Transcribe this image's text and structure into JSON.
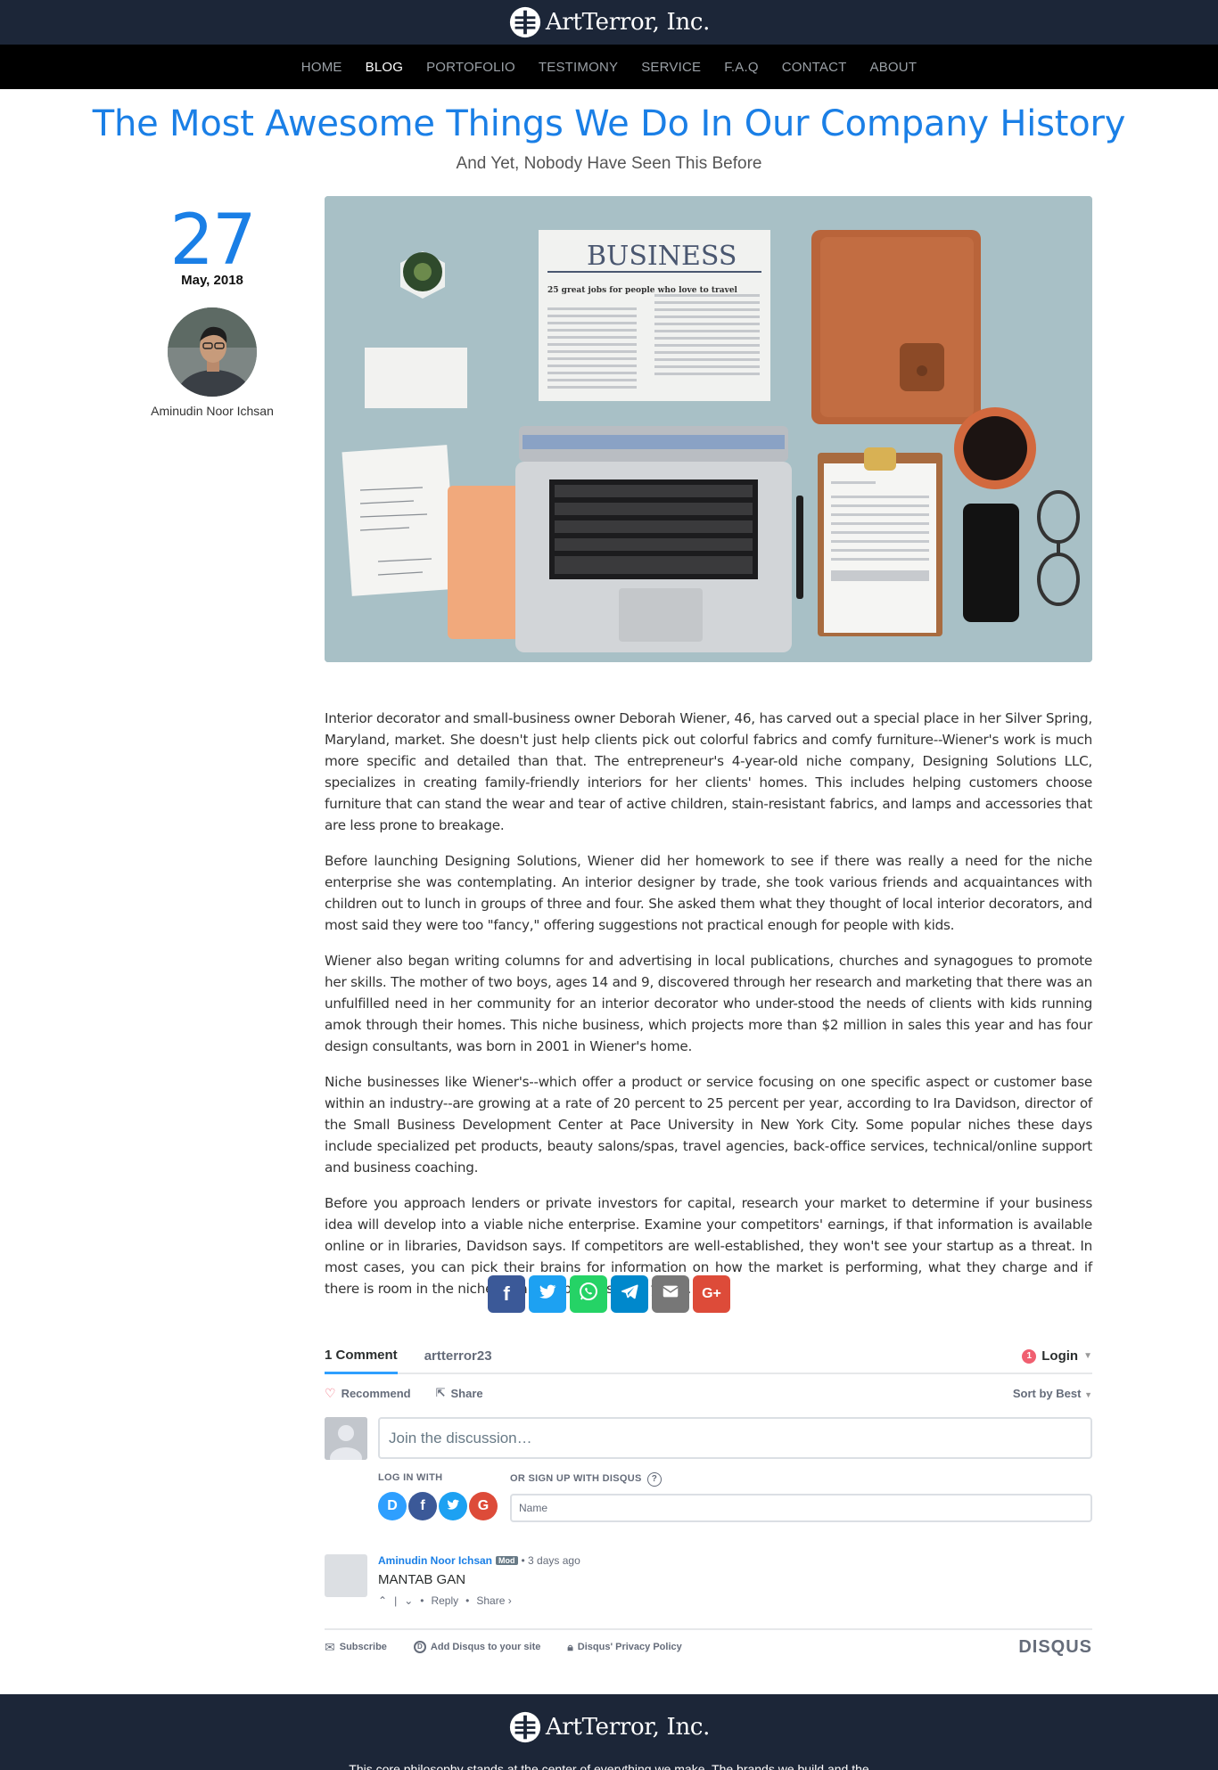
{
  "brand": {
    "name": "ArtTerror, Inc."
  },
  "nav": {
    "items": [
      "HOME",
      "BLOG",
      "PORTOFOLIO",
      "TESTIMONY",
      "SERVICE",
      "F.A.Q",
      "CONTACT",
      "ABOUT"
    ],
    "active": "BLOG"
  },
  "post": {
    "title": "The Most Awesome Things We Do In Our Company History",
    "subtitle": "And Yet, Nobody Have Seen This Before",
    "day": "27",
    "month_year": "May, 2018",
    "author": "Aminudin Noor Ichsan",
    "image_text": {
      "headline": "BUSINESS",
      "subhead": "25 great jobs for people who love to travel"
    },
    "paragraphs": [
      "Interior decorator and small-business owner Deborah Wiener, 46, has carved out a special place in her Silver Spring, Maryland, market. She doesn't just help clients pick out colorful fabrics and comfy furniture--Wiener's work is much more specific and detailed than that. The entrepreneur's 4-year-old niche company, Designing Solutions LLC, specializes in creating family-friendly interiors for her clients' homes. This includes helping customers choose furniture that can stand the wear and tear of active children, stain-resistant fabrics, and lamps and accessories that are less prone to breakage.",
      "Before launching Designing Solutions, Wiener did her homework to see if there was really a need for the niche enterprise she was contemplating. An interior designer by trade, she took various friends and acquaintances with children out to lunch in groups of three and four. She asked them what they thought of local interior decorators, and most said they were too \"fancy,\" offering suggestions not practical enough for people with kids.",
      "Wiener also began writing columns for and advertising in local publications, churches and synagogues to promote her skills. The mother of two boys, ages 14 and 9, discovered through her research and marketing that there was an unfulfilled need in her community for an interior decorator who under-stood the needs of clients with kids running amok through their homes. This niche business, which projects more than $2 million in sales this year and has four design consultants, was born in 2001 in Wiener's home.",
      "Niche businesses like Wiener's--which offer a product or service focusing on one specific aspect or customer base within an industry--are growing at a rate of 20 percent to 25 percent per year, according to Ira Davidson, director of the Small Business Development Center at Pace University in New York City. Some popular niches these days include specialized pet products, beauty salons/spas, travel agencies, back-office services, technical/online support and business coaching.",
      "Before you approach lenders or private investors for capital, research your market to determine if your business idea will develop into a viable niche enterprise. Examine your competitors' earnings, if that information is available online or in libraries, Davidson says. If competitors are well-established, they won't see your startup as a threat. In most cases, you can pick their brains for information on how the market is performing, what they charge and if there is room in the niche for a new business like yours."
    ]
  },
  "share": {
    "buttons": [
      {
        "name": "facebook-share-button",
        "icon": "facebook-icon",
        "glyph": "f",
        "color": "#3b5998"
      },
      {
        "name": "twitter-share-button",
        "icon": "twitter-icon",
        "glyph": "",
        "color": "#1da1f2"
      },
      {
        "name": "whatsapp-share-button",
        "icon": "whatsapp-icon",
        "glyph": "",
        "color": "#25d366"
      },
      {
        "name": "telegram-share-button",
        "icon": "telegram-icon",
        "glyph": "",
        "color": "#0088cc"
      },
      {
        "name": "email-share-button",
        "icon": "envelope-icon",
        "glyph": "",
        "color": "#777777"
      },
      {
        "name": "googleplus-share-button",
        "icon": "google-plus-icon",
        "glyph": "G+",
        "color": "#dd4b39"
      }
    ]
  },
  "disqus": {
    "tab_comments": "1 Comment",
    "tab_site": "artterror23",
    "login_badge": "1",
    "login": "Login",
    "recommend": "Recommend",
    "share": "Share",
    "sort": "Sort by Best",
    "placeholder": "Join the discussion…",
    "log_in_with": "LOG IN WITH",
    "sign_up": "OR SIGN UP WITH DISQUS",
    "name_placeholder": "Name",
    "social": [
      {
        "glyph": "D",
        "color": "#2e9fff",
        "icon": "disqus-icon"
      },
      {
        "glyph": "f",
        "color": "#3b5998",
        "icon": "facebook-icon"
      },
      {
        "glyph": "",
        "color": "#1da1f2",
        "icon": "twitter-icon"
      },
      {
        "glyph": "G",
        "color": "#dd4b39",
        "icon": "google-icon"
      }
    ],
    "comment": {
      "author": "Aminudin Noor Ichsan",
      "badge": "Mod",
      "time": "• 3 days ago",
      "text": "MANTAB GAN",
      "reply": "Reply",
      "share": "Share ›"
    },
    "footer": {
      "subscribe": "Subscribe",
      "add": "Add Disqus to your site",
      "privacy": "Disqus' Privacy Policy",
      "brand": "DISQUS"
    }
  },
  "footer": {
    "text": "This core philosophy stands at the center of everything we make. The brands we build and the"
  }
}
